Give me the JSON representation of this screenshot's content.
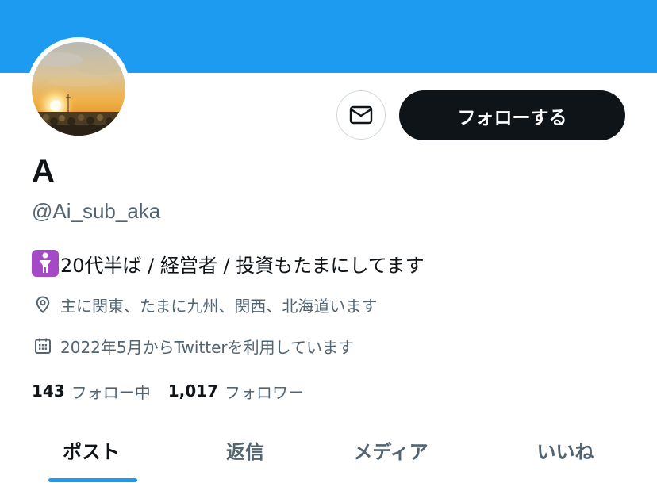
{
  "colors": {
    "banner": "#1d9bf0",
    "primary_text": "#0f1419",
    "secondary_text": "#536471",
    "follow_button_bg": "#0f1419",
    "tab_indicator": "#1d9bf0",
    "bio_emoji_bg": "#a44ac7"
  },
  "profile": {
    "display_name": "A",
    "handle": "@Ai_sub_aka",
    "bio_emoji_icon": "person-standing-emoji",
    "bio": "20代半ば / 経営者 / 投資もたまにしてます",
    "location": "主に関東、たまに九州、関西、北海道います",
    "joined": "2022年5月からTwitterを利用しています"
  },
  "actions": {
    "message_icon": "envelope-icon",
    "follow_label": "フォローする"
  },
  "stats": {
    "following_count": "143",
    "following_label": "フォロー中",
    "followers_count": "1,017",
    "followers_label": "フォロワー"
  },
  "tabs": [
    {
      "label": "ポスト",
      "active": true
    },
    {
      "label": "返信",
      "active": false
    },
    {
      "label": "メディア",
      "active": false
    },
    {
      "label": "いいね",
      "active": false
    }
  ]
}
